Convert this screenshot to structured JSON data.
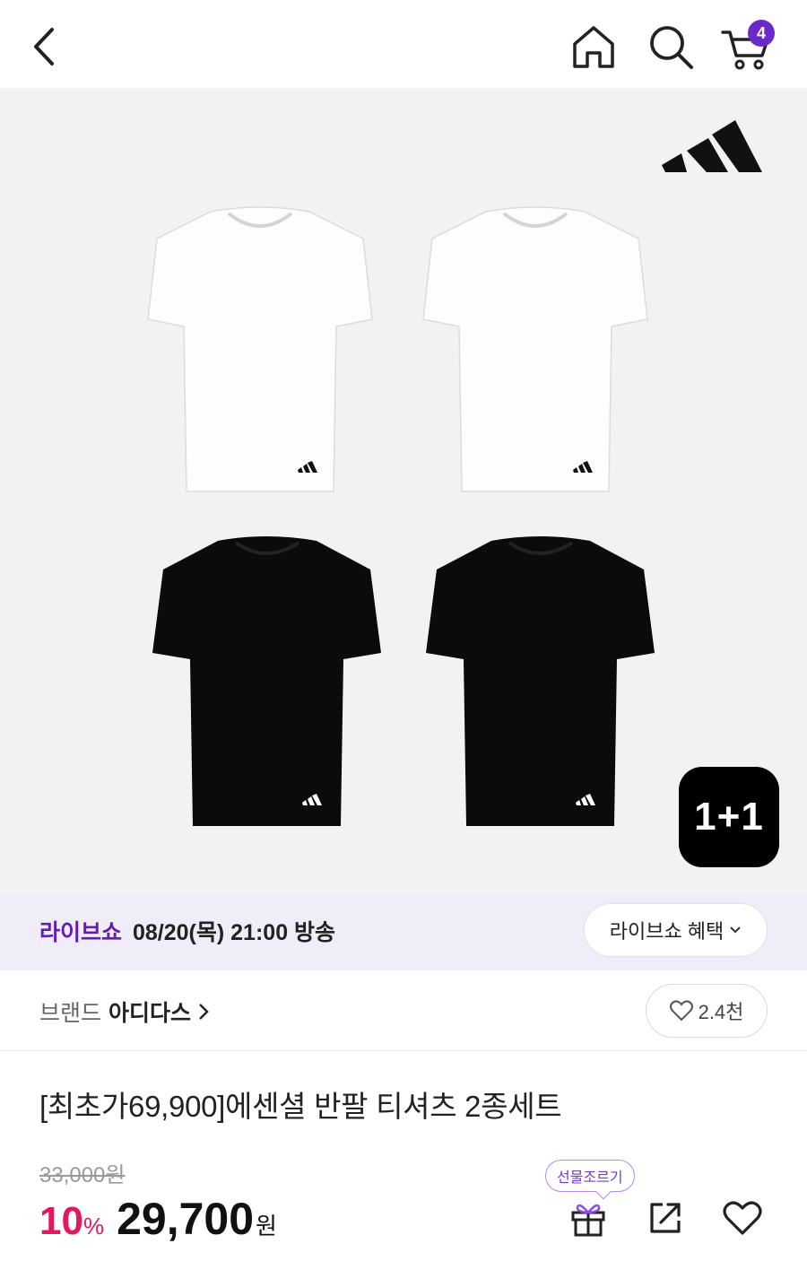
{
  "header": {
    "back_icon": "chevron-left-icon",
    "home_icon": "home-icon",
    "search_icon": "search-icon",
    "cart_icon": "cart-icon",
    "cart_count": "4",
    "accent_color": "#6b29c8"
  },
  "hero": {
    "brand_logo": "adidas-logo",
    "bundle_badge": "1+1"
  },
  "live": {
    "label": "라이브쇼",
    "schedule": "08/20(목) 21:00 방송",
    "benefit_button": "라이브쇼 혜택"
  },
  "brand": {
    "key": "브랜드",
    "name": "아디다스",
    "like_count": "2.4천"
  },
  "product": {
    "title": "[최초가69,900]에센셜 반팔 티셔츠 2종세트",
    "original_price": "33,000원",
    "discount": "10",
    "discount_unit": "%",
    "sale_price": "29,700",
    "currency": "원",
    "discount_color": "#e5175e"
  },
  "actions": {
    "gift_tooltip": "선물조르기",
    "gift_icon": "gift-icon",
    "share_icon": "share-icon",
    "wishlist_icon": "heart-icon"
  }
}
